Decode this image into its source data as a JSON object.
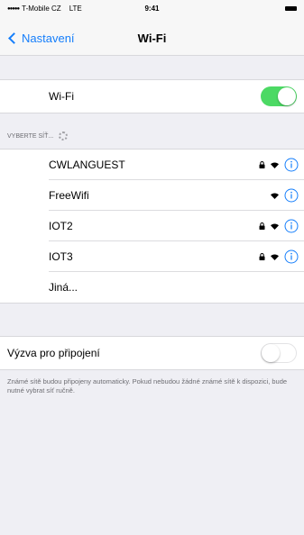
{
  "status_bar": {
    "carrier": "T-Mobile CZ",
    "network": "LTE",
    "time": "9:41"
  },
  "nav": {
    "back_label": "Nastavení",
    "title": "Wi-Fi"
  },
  "wifi_toggle": {
    "label": "Wi-Fi",
    "state": "on",
    "on_color": "#4cd964"
  },
  "networks_section": {
    "header": "VYBERTE SÍŤ..."
  },
  "networks": [
    {
      "name": "CWLANGUEST",
      "secured": true
    },
    {
      "name": "FreeWifi",
      "secured": false
    },
    {
      "name": "IOT2",
      "secured": true
    },
    {
      "name": "IOT3",
      "secured": true
    }
  ],
  "other_network": "Jiná...",
  "ask_to_join": {
    "label": "Výzva pro připojení",
    "state": "off",
    "description": "Známé sítě budou připojeny automaticky. Pokud nebudou žádné známé sítě k dispozici, bude nutné vybrat síť ručně."
  },
  "colors": {
    "accent": "#157efb",
    "background": "#efeff4"
  }
}
